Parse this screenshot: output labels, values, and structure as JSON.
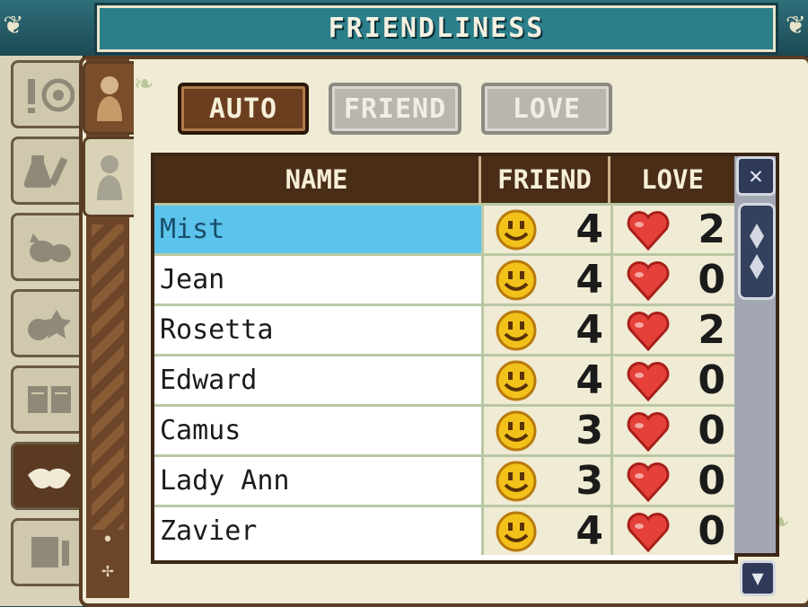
{
  "title": "FRIENDLINESS",
  "modes": [
    {
      "label": "AUTO",
      "active": true
    },
    {
      "label": "FRIEND",
      "active": false
    },
    {
      "label": "LOVE",
      "active": false
    }
  ],
  "table": {
    "headers": {
      "name": "NAME",
      "friend": "FRIEND",
      "love": "LOVE"
    },
    "rows": [
      {
        "name": "Mist",
        "friend": "4",
        "love": "2",
        "selected": true
      },
      {
        "name": "Jean",
        "friend": "4",
        "love": "0"
      },
      {
        "name": "Rosetta",
        "friend": "4",
        "love": "2"
      },
      {
        "name": "Edward",
        "friend": "4",
        "love": "0"
      },
      {
        "name": "Camus",
        "friend": "3",
        "love": "0"
      },
      {
        "name": "Lady Ann",
        "friend": "3",
        "love": "0"
      },
      {
        "name": "Zavier",
        "friend": "4",
        "love": "0"
      }
    ]
  },
  "icons": {
    "friend": "smiley-icon",
    "love": "heart-icon",
    "close": "close-x-icon",
    "scroll_down": "arrow-down-icon"
  },
  "colors": {
    "selected_row": "#5cc3ec",
    "header_bg": "#4a2d17",
    "active_button": "#6a3e1f",
    "inactive_button": "#b9b6ae",
    "heart": "#e5413a",
    "smiley": "#f2c21b"
  }
}
